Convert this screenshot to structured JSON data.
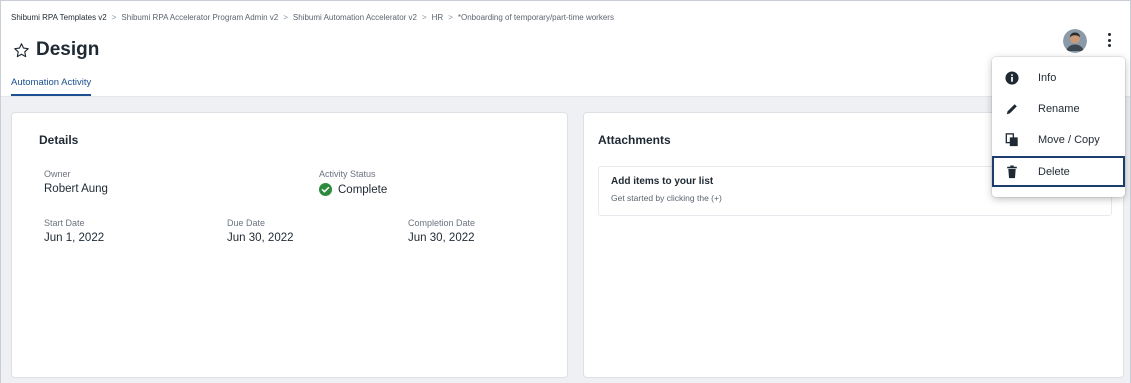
{
  "breadcrumb": [
    "Shibumi RPA Templates v2",
    "Shibumi RPA Accelerator Program Admin v2",
    "Shibumi Automation Accelerator v2",
    "HR",
    "*Onboarding of temporary/part-time workers"
  ],
  "breadcrumb_separator": ">",
  "header": {
    "title": "Design",
    "star_icon": "star-outline-icon"
  },
  "tabs": [
    {
      "label": "Automation Activity",
      "active": true
    }
  ],
  "details": {
    "title": "Details",
    "owner": {
      "label": "Owner",
      "value": "Robert Aung"
    },
    "activity_status": {
      "label": "Activity Status",
      "value": "Complete",
      "icon": "check-circle-icon",
      "color": "#2e8b3e"
    },
    "start_date": {
      "label": "Start Date",
      "value": "Jun 1, 2022"
    },
    "due_date": {
      "label": "Due Date",
      "value": "Jun 30, 2022"
    },
    "completion_date": {
      "label": "Completion Date",
      "value": "Jun 30, 2022"
    }
  },
  "attachments": {
    "title": "Attachments",
    "empty_title": "Add items to your list",
    "empty_subtitle": "Get started by clicking the (+)"
  },
  "menu": {
    "items": [
      {
        "label": "Info",
        "icon": "info-icon"
      },
      {
        "label": "Rename",
        "icon": "pencil-icon"
      },
      {
        "label": "Move / Copy",
        "icon": "copy-icon"
      },
      {
        "label": "Delete",
        "icon": "trash-icon",
        "selected": true
      }
    ]
  },
  "colors": {
    "accent": "#1b4f8f",
    "selection_outline": "#1c3d6e",
    "status_complete": "#2e8b3e"
  }
}
